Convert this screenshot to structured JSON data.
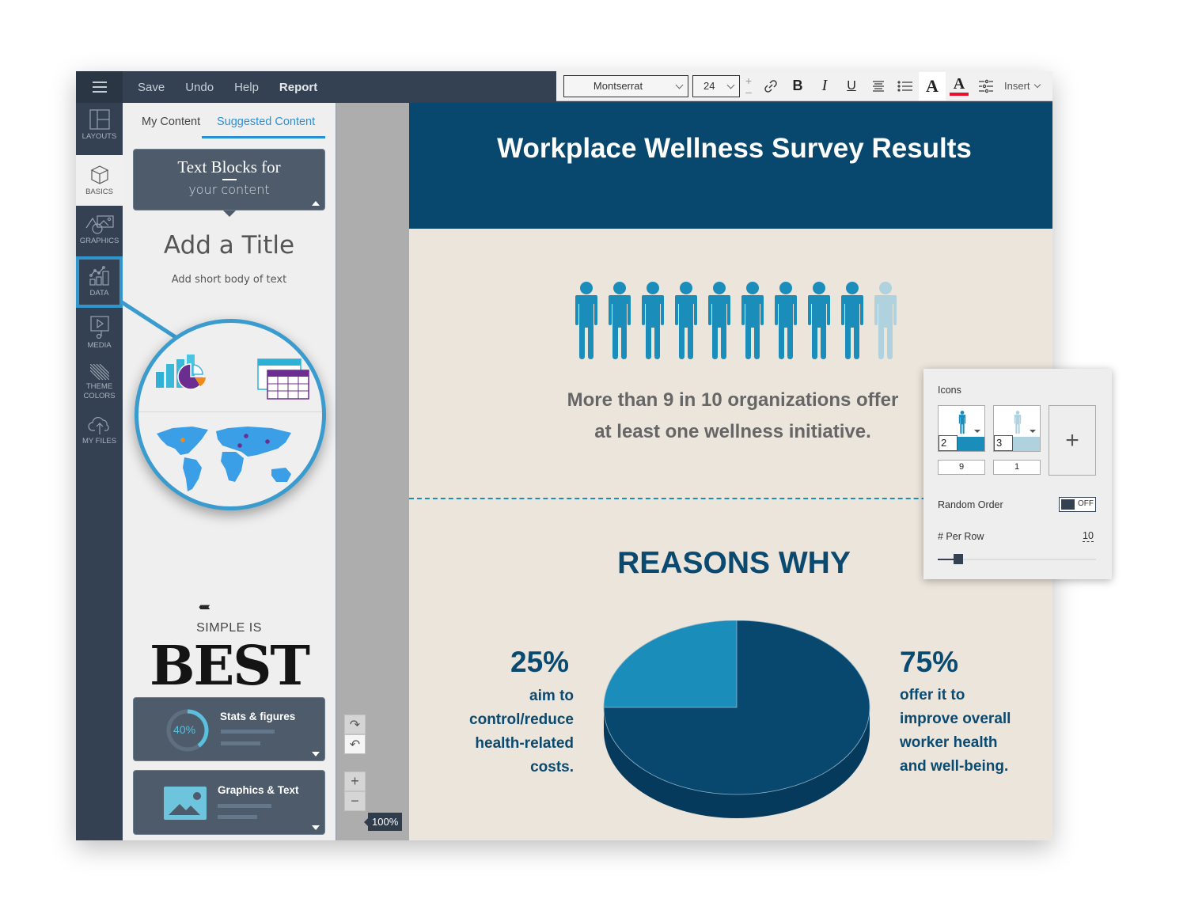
{
  "menu": {
    "items": [
      {
        "label": "Save"
      },
      {
        "label": "Undo"
      },
      {
        "label": "Help"
      },
      {
        "label": "Report"
      }
    ]
  },
  "toolbar": {
    "font": "Montserrat",
    "size": "24",
    "bold_glyph": "B",
    "italic_glyph": "I",
    "underline_glyph": "U",
    "text_color_glyph": "A",
    "highlight_glyph": "A",
    "text_color": "#e8112d",
    "insert_label": "Insert"
  },
  "sidebar": {
    "items": [
      {
        "label": "LAYOUTS",
        "icon": "layout-icon"
      },
      {
        "label": "BASICS",
        "icon": "cube-icon",
        "active": true
      },
      {
        "label": "GRAPHICS",
        "icon": "shapes-icon"
      },
      {
        "label": "DATA",
        "icon": "chart-icon",
        "selected": true
      },
      {
        "label": "MEDIA",
        "icon": "media-icon"
      },
      {
        "label": "THEME\nCOLORS",
        "icon": "stripes-icon"
      },
      {
        "label": "MY FILES",
        "icon": "cloud-upload-icon"
      }
    ]
  },
  "panel": {
    "tabs": [
      {
        "label": "My Content"
      },
      {
        "label": "Suggested Content",
        "active": true
      }
    ],
    "text_blocks_card": {
      "line1": "Text Blocks for",
      "line2": "your content"
    },
    "add_title": "Add a Title",
    "add_body": "Add short body of text",
    "simple_is": "SIMPLE IS",
    "best": "BEST",
    "stats_card": {
      "title": "Stats & figures",
      "percent": "40%",
      "progress": 0.4
    },
    "graphics_card": {
      "title": "Graphics & Text"
    }
  },
  "zoom": {
    "level": "100%"
  },
  "document": {
    "title": "Workplace Wellness Survey Results",
    "stat_line1": "More than 9 in 10 organizations offer",
    "stat_line2": "at least one wellness initiative.",
    "pictogram": {
      "filled": 9,
      "empty": 1,
      "filled_color": "#1a8dbb",
      "empty_color": "#b0d2de"
    },
    "reasons_heading": "REASONS WHY",
    "left_pct": "25%",
    "left_desc": [
      "aim to",
      "control/reduce",
      "health-related",
      "costs."
    ],
    "right_pct": "75%",
    "right_desc": [
      "offer it to",
      "improve overall",
      "worker health",
      "and well-being."
    ]
  },
  "chart_data": {
    "type": "pie",
    "title": "REASONS WHY",
    "categories": [
      "aim to control/reduce health-related costs",
      "offer it to improve overall worker health and well-being"
    ],
    "values": [
      25,
      75
    ],
    "colors": [
      "#1a8dbb",
      "#08486f"
    ],
    "unit": "%"
  },
  "icons_panel": {
    "label": "Icons",
    "icon1": {
      "size": "2",
      "count": "9",
      "color": "#1a8dbb"
    },
    "icon2": {
      "size": "3",
      "count": "1",
      "color": "#b0d2de"
    },
    "random_order_label": "Random Order",
    "random_order_state": "OFF",
    "per_row_label": "# Per Row",
    "per_row_value": "10",
    "per_row_slider": 0.1
  }
}
